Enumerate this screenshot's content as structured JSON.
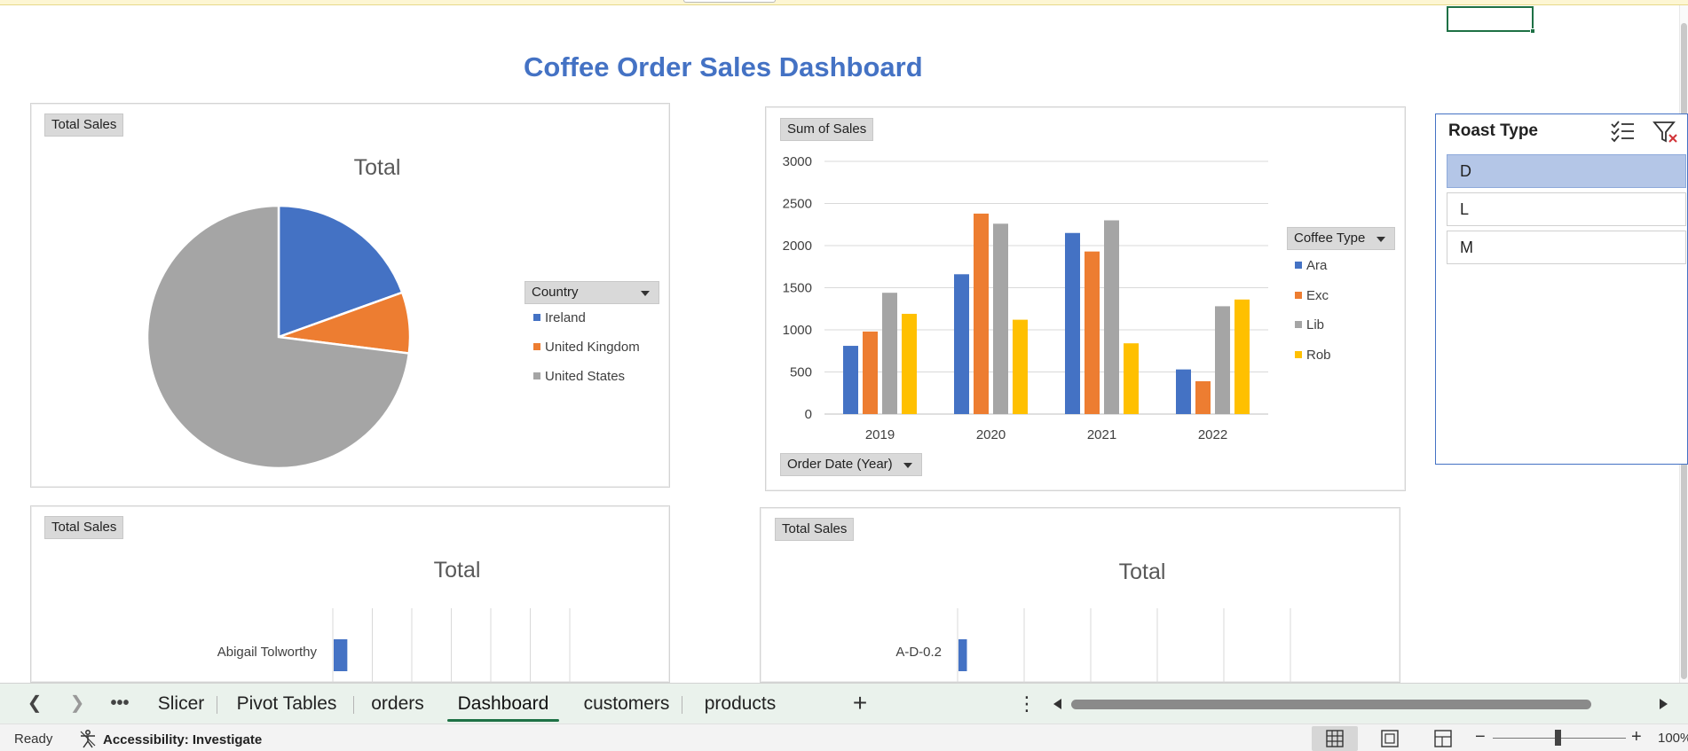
{
  "dashboard": {
    "title": "Coffee Order Sales Dashboard"
  },
  "pie_panel": {
    "field_label": "Total Sales",
    "legend_field": "Country"
  },
  "bar_panel": {
    "value_field": "Sum of Sales",
    "legend_field": "Coffee Type",
    "axis_field": "Order Date (Year)"
  },
  "customer_panel": {
    "field_label": "Total Sales"
  },
  "product_panel": {
    "field_label": "Total Sales"
  },
  "slicer": {
    "title": "Roast Type",
    "items": [
      {
        "label": "D",
        "selected": true
      },
      {
        "label": "L",
        "selected": false
      },
      {
        "label": "M",
        "selected": false
      }
    ]
  },
  "tabs": {
    "more_label": "•••",
    "sheets": [
      {
        "label": "Slicer",
        "active": false
      },
      {
        "label": "Pivot Tables",
        "active": false
      },
      {
        "label": "orders",
        "active": false
      },
      {
        "label": "Dashboard",
        "active": true
      },
      {
        "label": "customers",
        "active": false
      },
      {
        "label": "products",
        "active": false
      }
    ],
    "add_label": "+"
  },
  "status": {
    "ready": "Ready",
    "accessibility": "Accessibility: Investigate",
    "zoom": "100%"
  },
  "colors": {
    "accent_blue": "#4472c4",
    "orange": "#ed7d31",
    "gray": "#a5a5a5",
    "yellow": "#ffc000",
    "excel_green": "#1e7145"
  },
  "chart_data": [
    {
      "type": "pie",
      "title": "Total",
      "categories": [
        "Ireland",
        "United Kingdom",
        "United States"
      ],
      "values": [
        19.5,
        7.5,
        73
      ],
      "colors": [
        "#4472c4",
        "#ed7d31",
        "#a5a5a5"
      ]
    },
    {
      "type": "bar",
      "title": "",
      "categories": [
        "2019",
        "2020",
        "2021",
        "2022"
      ],
      "series": [
        {
          "name": "Ara",
          "values": [
            810,
            1660,
            2150,
            530
          ],
          "color": "#4472c4"
        },
        {
          "name": "Exc",
          "values": [
            980,
            2380,
            1930,
            390
          ],
          "color": "#ed7d31"
        },
        {
          "name": "Lib",
          "values": [
            1440,
            2260,
            2300,
            1280
          ],
          "color": "#a5a5a5"
        },
        {
          "name": "Rob",
          "values": [
            1190,
            1120,
            840,
            1360
          ],
          "color": "#ffc000"
        }
      ],
      "ylim": [
        0,
        3000
      ],
      "yticks": [
        0,
        500,
        1000,
        1500,
        2000,
        2500,
        3000
      ],
      "grid": true,
      "legend": "right"
    },
    {
      "type": "bar",
      "title": "Total",
      "orientation": "horizontal",
      "categories": [
        "Abigail Tolworthy"
      ],
      "values": [
        0.15
      ],
      "color": "#4472c4"
    },
    {
      "type": "bar",
      "title": "Total",
      "orientation": "horizontal",
      "categories": [
        "A-D-0.2"
      ],
      "values": [
        0.05
      ],
      "color": "#4472c4"
    }
  ]
}
